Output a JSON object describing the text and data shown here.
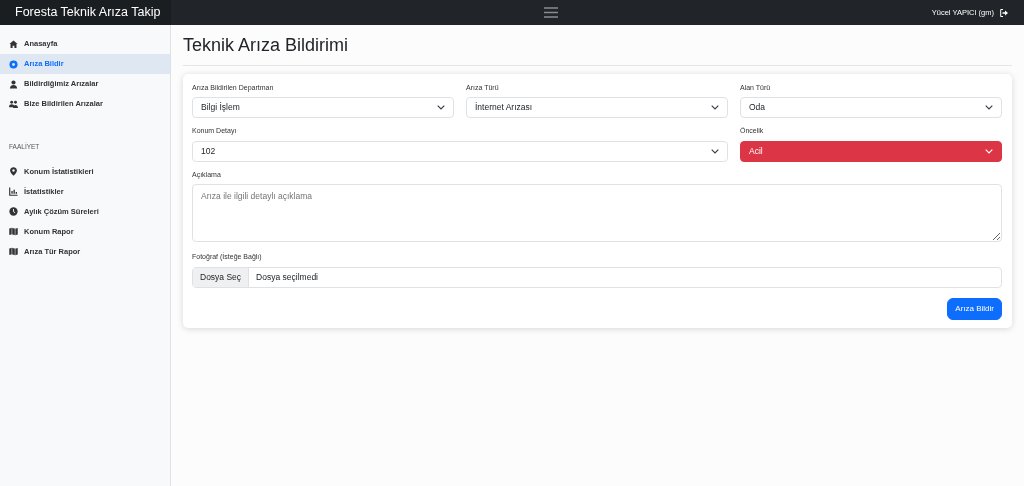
{
  "navbar": {
    "brand": "Foresta Teknik Arıza Takip",
    "user": "Yücel YAPICI (gm)"
  },
  "sidebar": {
    "sections": [
      {
        "items": [
          {
            "label": "Anasayfa",
            "selected": false
          },
          {
            "label": "Arıza Bildir",
            "selected": true
          },
          {
            "label": "Bildirdiğimiz Arızalar",
            "selected": false
          },
          {
            "label": "Bize Bildirilen Arızalar",
            "selected": false
          }
        ]
      },
      {
        "heading": "FAALİYET",
        "items": [
          {
            "label": "Konum İstatistikleri",
            "selected": false
          },
          {
            "label": "İstatistikler",
            "selected": false
          },
          {
            "label": "Aylık Çözüm Süreleri",
            "selected": false
          },
          {
            "label": "Konum Rapor",
            "selected": false
          },
          {
            "label": "Arıza Tür Rapor",
            "selected": false
          }
        ]
      }
    ]
  },
  "page": {
    "title": "Teknik Arıza Bildirimi"
  },
  "form": {
    "fields": [
      {
        "kind": "select",
        "label": "Arıza Bildirilen Departman",
        "value": "Bilgi İşlem",
        "urgent": false
      },
      {
        "kind": "select",
        "label": "Arıza Türü",
        "value": "İnternet Arızası",
        "urgent": false
      },
      {
        "kind": "select",
        "label": "Alan Türü",
        "value": "Oda",
        "urgent": false
      },
      {
        "kind": "select",
        "label": "Konum Detayı",
        "value": "102",
        "urgent": false
      },
      {
        "kind": "select",
        "label": "Öncelik",
        "value": "Acil",
        "urgent": true
      },
      {
        "kind": "textarea",
        "label": "Açıklama",
        "placeholder": "Arıza ile ilgili detaylı açıklama"
      },
      {
        "kind": "file",
        "label": "Fotoğraf (İsteğe Bağlı)",
        "button": "Dosya Seç",
        "status": "Dosya seçilmedi"
      }
    ],
    "submit": "Arıza Bildir"
  }
}
